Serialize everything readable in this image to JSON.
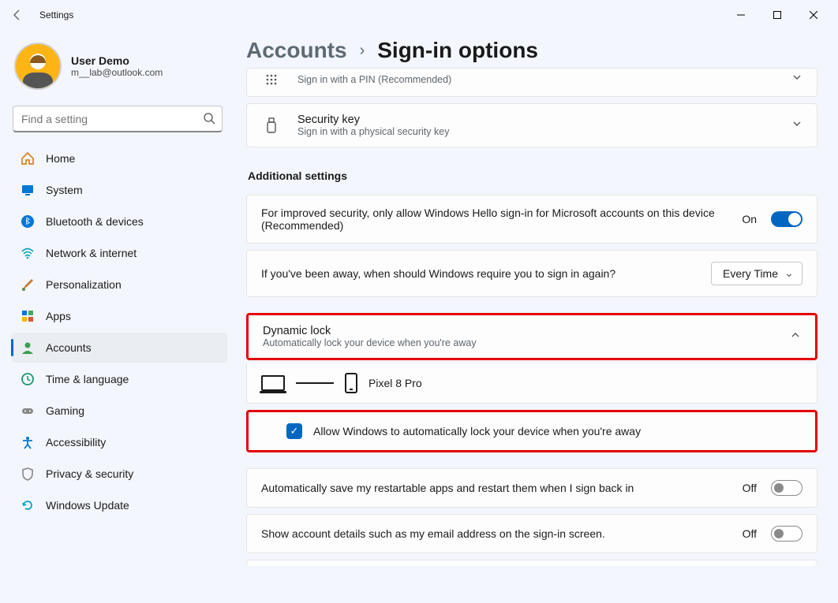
{
  "window": {
    "title": "Settings"
  },
  "profile": {
    "name": "User Demo",
    "email": "m__lab@outlook.com"
  },
  "search": {
    "placeholder": "Find a setting"
  },
  "nav": {
    "home": "Home",
    "system": "System",
    "bluetooth": "Bluetooth & devices",
    "network": "Network & internet",
    "personalization": "Personalization",
    "apps": "Apps",
    "accounts": "Accounts",
    "time": "Time & language",
    "gaming": "Gaming",
    "accessibility": "Accessibility",
    "privacy": "Privacy & security",
    "update": "Windows Update"
  },
  "breadcrumb": {
    "parent": "Accounts",
    "current": "Sign-in options"
  },
  "cards": {
    "pin_sub": "Sign in with a PIN (Recommended)",
    "seckey_title": "Security key",
    "seckey_sub": "Sign in with a physical security key"
  },
  "section": {
    "additional": "Additional settings"
  },
  "rows": {
    "hello_only": "For improved security, only allow Windows Hello sign-in for Microsoft accounts on this device (Recommended)",
    "hello_state": "On",
    "away_prompt": "If you've been away, when should Windows require you to sign in again?",
    "away_value": "Every Time",
    "dynlock_title": "Dynamic lock",
    "dynlock_sub": "Automatically lock your device when you're away",
    "paired_device": "Pixel 8 Pro",
    "allow_autolock": "Allow Windows to automatically lock your device when you're away",
    "restart_apps": "Automatically save my restartable apps and restart them when I sign back in",
    "restart_state": "Off",
    "show_details": "Show account details such as my email address on the sign-in screen.",
    "show_state": "Off"
  }
}
